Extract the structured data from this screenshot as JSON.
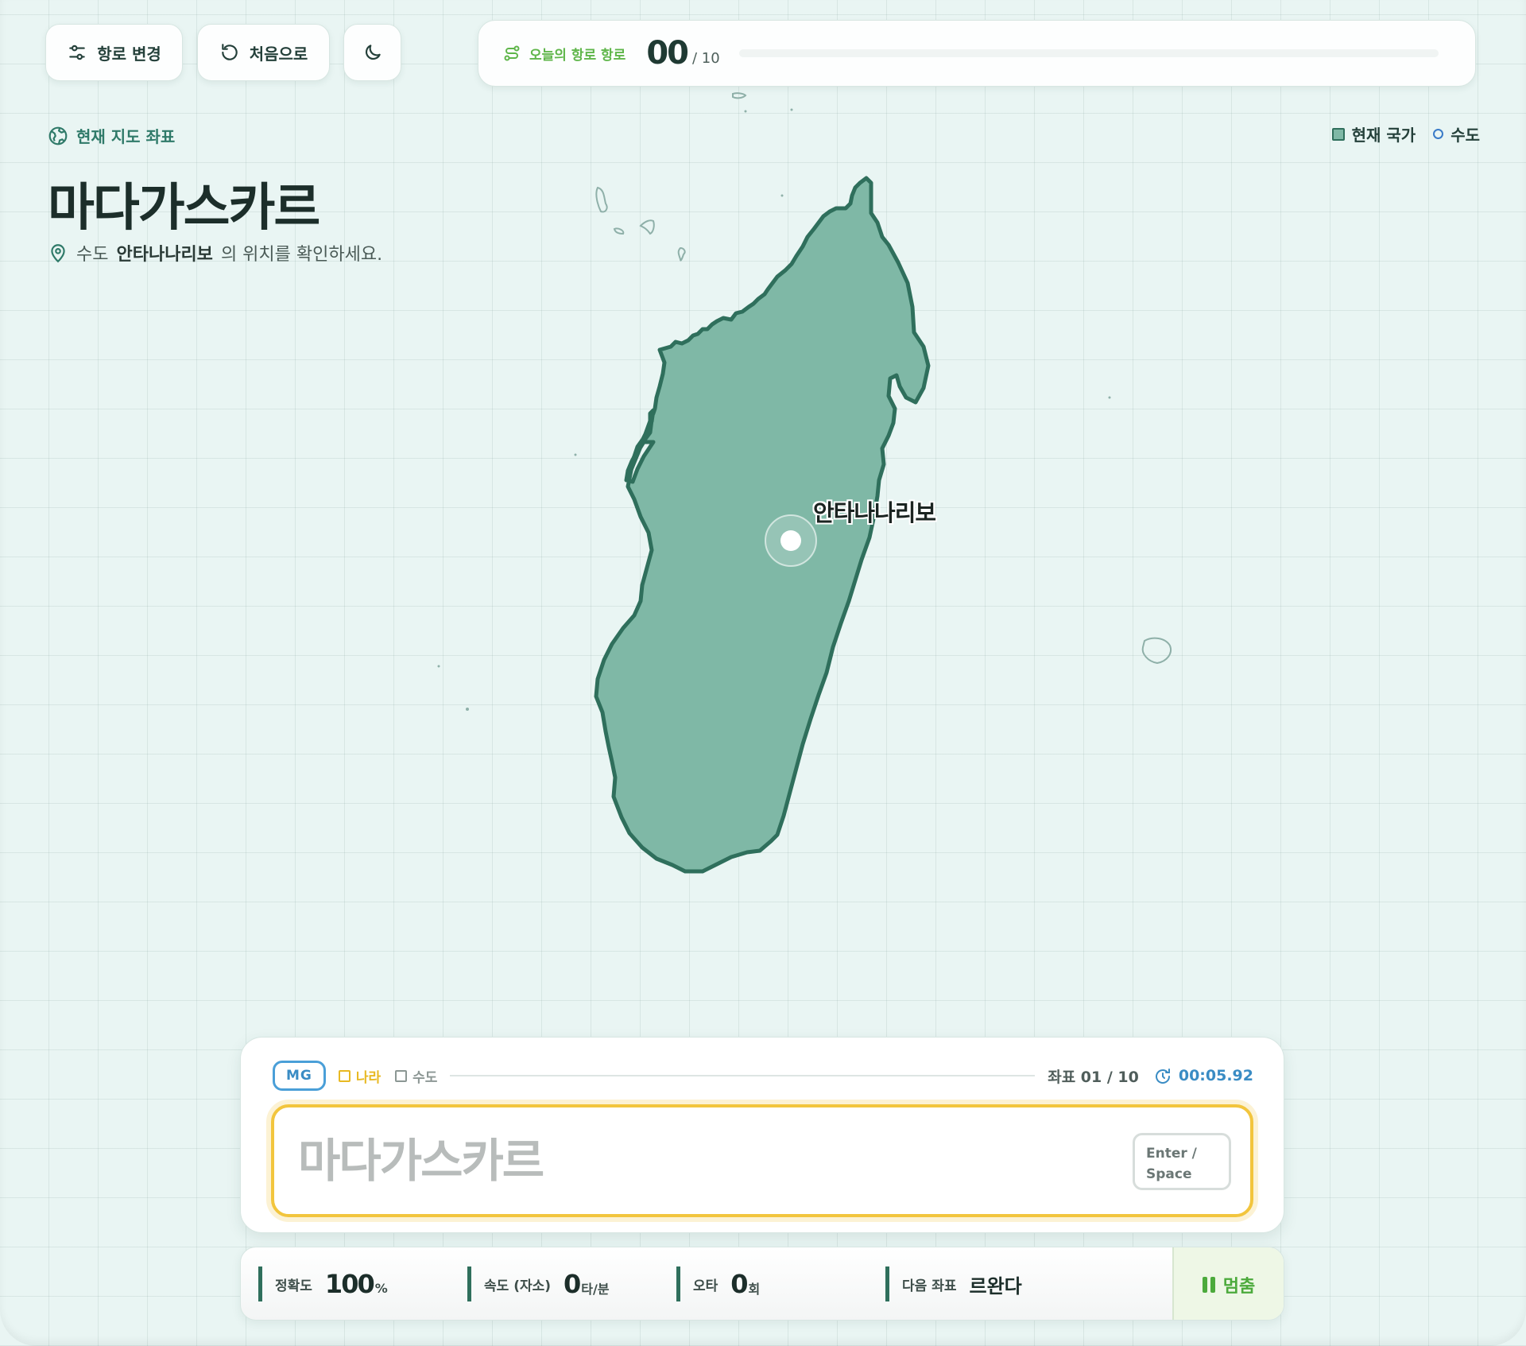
{
  "toolbar": {
    "route_label": "항로 변경",
    "restart_label": "처음으로"
  },
  "progress": {
    "label": "오늘의 항로 항로",
    "count": "00",
    "total": "/ 10",
    "fraction": 0
  },
  "header": {
    "coord_label": "현재 지도 좌표",
    "country_name": "마다가스카르",
    "hint_prefix": "수도",
    "hint_capital": "안타나나리보",
    "hint_suffix": "의 위치를 확인하세요."
  },
  "legend": {
    "country": "현재 국가",
    "capital": "수도"
  },
  "map": {
    "capital_label": "안타나나리보",
    "country_color": "#7fb8a6",
    "border_color": "#2f6f5c"
  },
  "input_panel": {
    "code": "MG",
    "check_country": "나라",
    "check_capital": "수도",
    "coord_count": "좌표 01 / 10",
    "timer": "00:05.92",
    "placeholder": "마다가스카르",
    "enter_key": "Enter / Space"
  },
  "stats": {
    "accuracy_label": "정확도",
    "accuracy_value": "100",
    "accuracy_unit": "%",
    "speed_label": "속도 (자소)",
    "speed_value": "0",
    "speed_unit": "타/분",
    "typo_label": "오타",
    "typo_value": "0",
    "typo_unit": "회",
    "next_label": "다음 좌표",
    "next_value": "르완다",
    "pause_label": "멈춤"
  },
  "colors": {
    "accent_green": "#5fb64a",
    "dark_green": "#2f6f5c",
    "accent_yellow": "#f2c53d",
    "accent_blue": "#3a8cc4"
  }
}
